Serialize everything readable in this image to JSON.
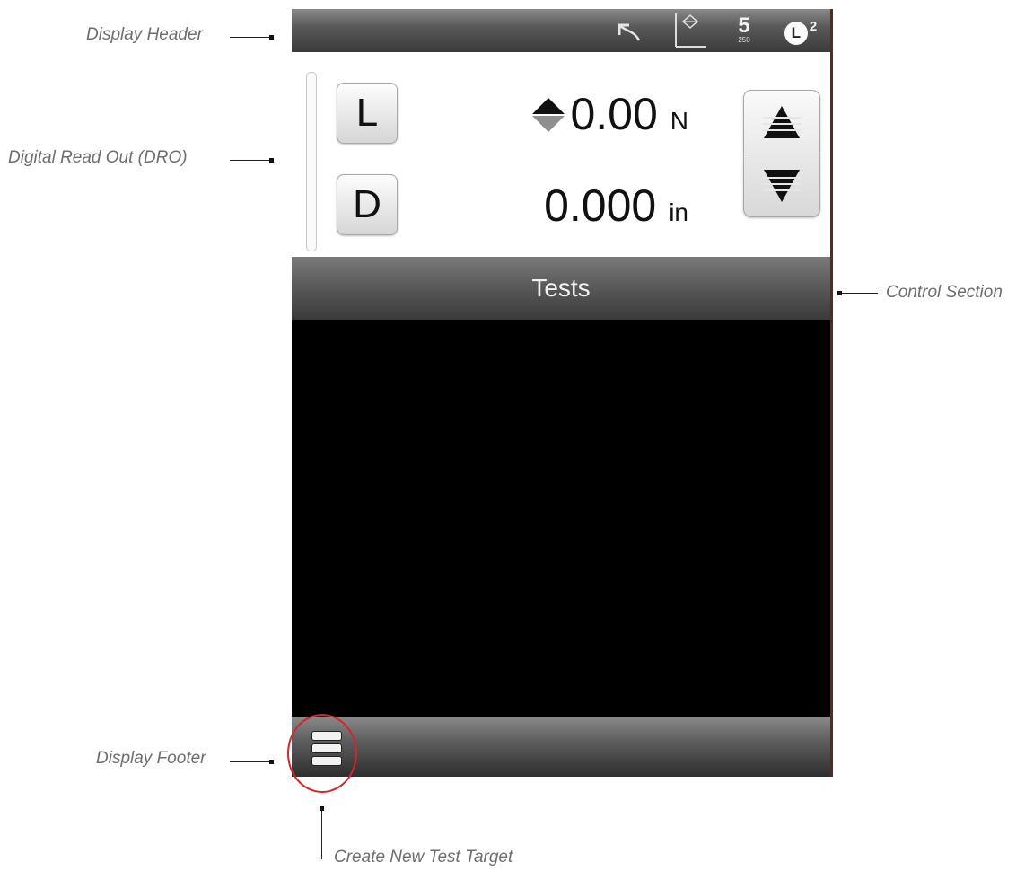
{
  "callouts": {
    "display_header": "Display Header",
    "dro": "Digital Read Out (DRO)",
    "control_section": "Control Section",
    "display_footer": "Display Footer",
    "create_new_test": "Create New Test Target"
  },
  "header": {
    "icons": [
      "undo-icon",
      "axis-graph-icon",
      "sample-rate-icon",
      "load-cell-icon"
    ],
    "sample_rate_value": "5",
    "sample_rate_sub": "250",
    "load_cell_letter": "L",
    "load_cell_superscript": "2"
  },
  "dro": {
    "load_button": "L",
    "distance_button": "D",
    "load_value": "0.00",
    "load_unit": "N",
    "distance_value": "0.000",
    "distance_unit": "in"
  },
  "control": {
    "title": "Tests"
  },
  "colors": {
    "highlight_circle": "#d3262c",
    "callout_text": "#6e6e6e"
  }
}
